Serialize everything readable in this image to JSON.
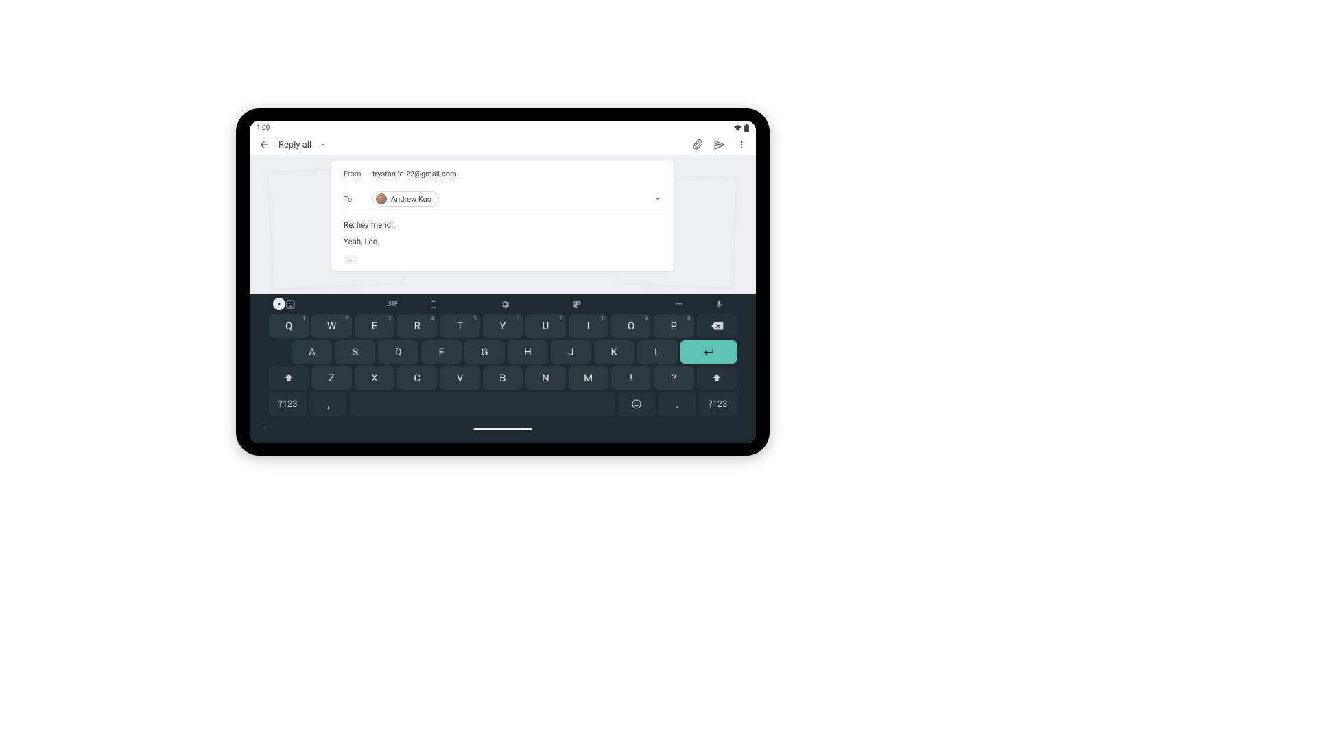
{
  "status": {
    "time": "1:00"
  },
  "appbar": {
    "title": "Reply all"
  },
  "compose": {
    "from_label": "From",
    "from_value": "trystan.io.22@gmail.com",
    "to_label": "To",
    "to_chip_name": "Andrew Kuo",
    "subject": "Re: hey friend!",
    "body": "Yeah, I do.",
    "thread_ellipsis": "…"
  },
  "keyboard": {
    "toolbar_gif_label": "GIF",
    "toolbar_more_label": "•••",
    "row1": [
      {
        "k": "Q",
        "h": "1"
      },
      {
        "k": "W",
        "h": "2"
      },
      {
        "k": "E",
        "h": "3"
      },
      {
        "k": "R",
        "h": "4"
      },
      {
        "k": "T",
        "h": "5"
      },
      {
        "k": "Y",
        "h": "6"
      },
      {
        "k": "U",
        "h": "7"
      },
      {
        "k": "I",
        "h": "8"
      },
      {
        "k": "O",
        "h": "9"
      },
      {
        "k": "P",
        "h": "0"
      }
    ],
    "row2": [
      {
        "k": "A"
      },
      {
        "k": "S"
      },
      {
        "k": "D"
      },
      {
        "k": "F"
      },
      {
        "k": "G"
      },
      {
        "k": "H"
      },
      {
        "k": "J"
      },
      {
        "k": "K"
      },
      {
        "k": "L"
      }
    ],
    "row3": [
      {
        "k": "Z"
      },
      {
        "k": "X"
      },
      {
        "k": "C"
      },
      {
        "k": "V"
      },
      {
        "k": "B"
      },
      {
        "k": "N"
      },
      {
        "k": "M"
      },
      {
        "k": "!"
      },
      {
        "k": "?"
      }
    ],
    "numswitch_label": "?123",
    "comma": ",",
    "period": "."
  }
}
